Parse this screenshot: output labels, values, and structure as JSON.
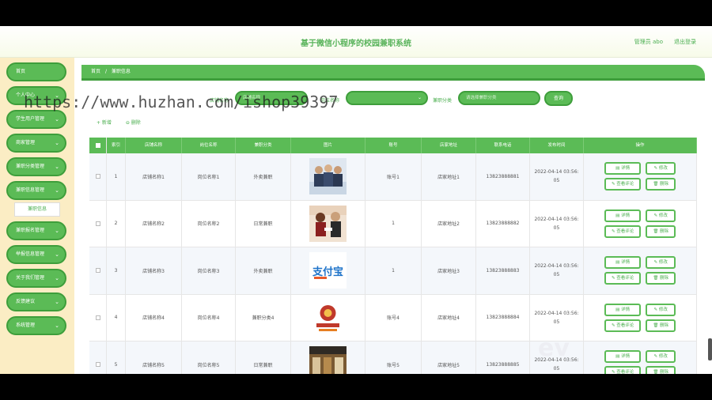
{
  "header": {
    "title": "基于微信小程序的校园兼职系统",
    "user": "管理员 abo",
    "logout": "退出登录"
  },
  "sidebar": {
    "items": [
      {
        "label": "首页",
        "chevron": ""
      },
      {
        "label": "个人中心",
        "chevron": "⌄"
      },
      {
        "label": "学生用户管理",
        "chevron": "⌄"
      },
      {
        "label": "商家管理",
        "chevron": "⌄"
      },
      {
        "label": "兼职分类管理",
        "chevron": "⌄"
      },
      {
        "label": "兼职信息管理",
        "chevron": "⌄"
      },
      {
        "label": "兼职报名管理",
        "chevron": "⌄"
      },
      {
        "label": "举报信息管理",
        "chevron": "⌄"
      },
      {
        "label": "关于我们管理",
        "chevron": "⌄"
      },
      {
        "label": "反馈建议",
        "chevron": "⌄"
      },
      {
        "label": "系统管理",
        "chevron": "⌄"
      }
    ],
    "sub_item": "兼职信息"
  },
  "breadcrumb": {
    "home": "首页",
    "sep": "/",
    "current": "兼职信息"
  },
  "search": {
    "store_label": "店铺名称",
    "store_placeholder": "店铺名称",
    "job_label": "岗位名称",
    "job_placeholder": "",
    "category_label": "兼职分类",
    "category_placeholder": "请选择兼职分类",
    "query_button": "查询"
  },
  "toolbar": {
    "add": "+ 新增",
    "delete": "⊖ 删除"
  },
  "table": {
    "headers": [
      "",
      "索引",
      "店铺名称",
      "岗位名称",
      "兼职分类",
      "图片",
      "账号",
      "店家地址",
      "联系电话",
      "发布时间",
      "操作"
    ],
    "rows": [
      {
        "index": "1",
        "store": "店铺名称1",
        "job": "岗位名称1",
        "category": "外卖兼职",
        "account": "账号1",
        "address": "店家地址1",
        "phone": "13823888881",
        "time_a": "2022-04-14 03:56:",
        "time_b": "05"
      },
      {
        "index": "2",
        "store": "店铺名称2",
        "job": "岗位名称2",
        "category": "日常兼职",
        "account": "1",
        "address": "店家地址2",
        "phone": "13823888882",
        "time_a": "2022-04-14 03:56:",
        "time_b": "05"
      },
      {
        "index": "3",
        "store": "店铺名称3",
        "job": "岗位名称3",
        "category": "外卖兼职",
        "account": "1",
        "address": "店家地址3",
        "phone": "13823888883",
        "time_a": "2022-04-14 03:56:",
        "time_b": "05"
      },
      {
        "index": "4",
        "store": "店铺名称4",
        "job": "岗位名称4",
        "category": "兼职分类4",
        "account": "账号4",
        "address": "店家地址4",
        "phone": "13823888884",
        "time_a": "2022-04-14 03:56:",
        "time_b": "05"
      },
      {
        "index": "5",
        "store": "店铺名称5",
        "job": "岗位名称5",
        "category": "日常兼职",
        "account": "账号5",
        "address": "店家地址5",
        "phone": "13823888885",
        "time_a": "2022-04-14 03:56:",
        "time_b": "05"
      }
    ],
    "ops": {
      "detail": "▤ 详情",
      "edit": "✎ 修改",
      "review": "✎ 查看评论",
      "remove": "🗑 删除"
    }
  },
  "watermark": "https://www.huzhan.com/ishop39397",
  "overlay_logo": "ev",
  "colors": {
    "primary": "#5bbb56",
    "primary_dark": "#3e9e3b",
    "sidebar_bg": "#fbedc4"
  }
}
